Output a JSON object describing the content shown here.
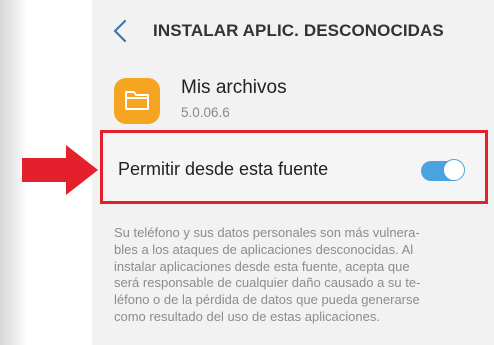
{
  "header": {
    "title": "INSTALAR APLIC. DESCONOCIDAS",
    "back_icon": "chevron-left-icon"
  },
  "app": {
    "name": "Mis archivos",
    "version": "5.0.06.6",
    "icon": "folder-icon",
    "icon_color": "#f6a523"
  },
  "permission": {
    "label": "Permitir desde esta fuente",
    "enabled": true,
    "toggle_color": "#4aa3df",
    "highlight_color": "#e3202c"
  },
  "description": "Su teléfono y sus datos personales son más vulnera-\nbles a los ataques de aplicaciones desconocidas. Al\ninstalar aplicaciones desde esta fuente, acepta que\nserá responsable de cualquier daño causado a su te-\nléfono o de la pérdida de datos que pueda generarse\ncomo resultado del uso de estas aplicaciones.",
  "annotation": {
    "arrow_icon": "right-arrow-icon",
    "arrow_color": "#e3202c"
  }
}
